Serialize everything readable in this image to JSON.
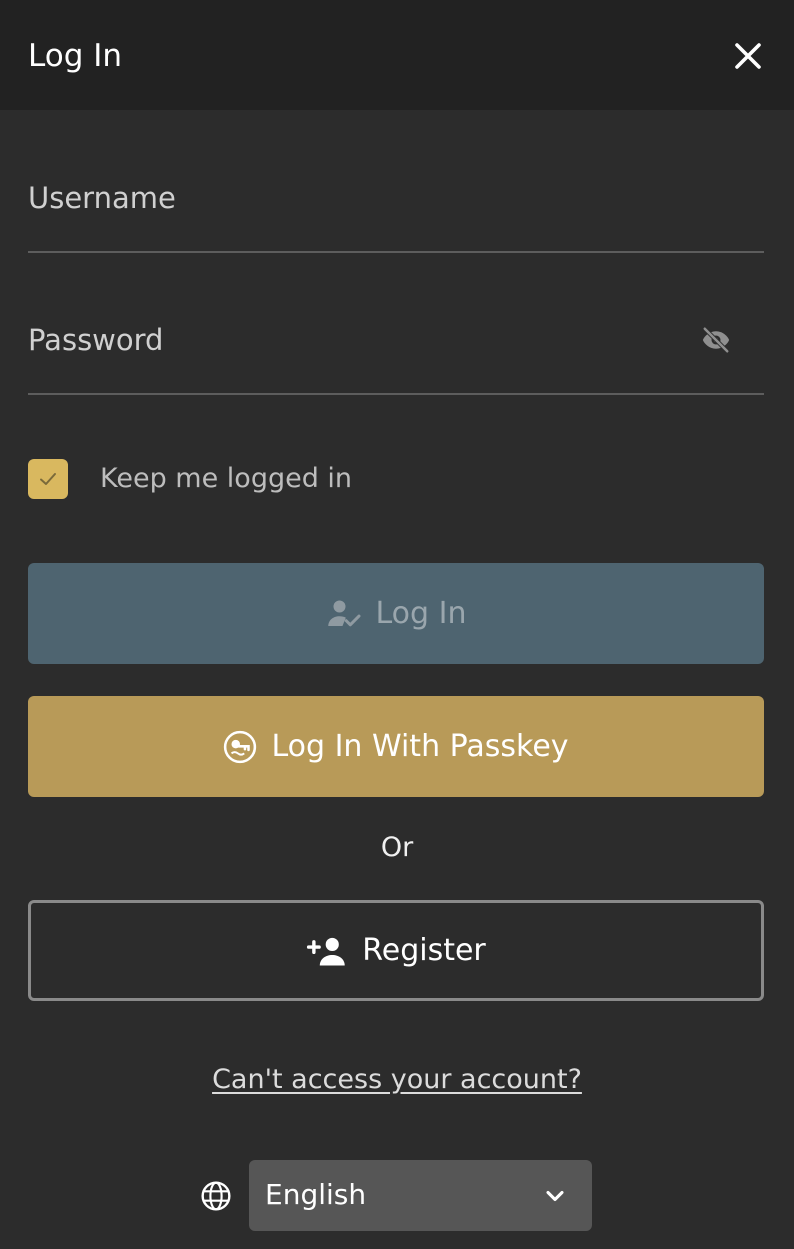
{
  "header": {
    "title": "Log In"
  },
  "form": {
    "username_placeholder": "Username",
    "username_value": "",
    "password_placeholder": "Password",
    "password_value": "",
    "keep_logged_in_label": "Keep me logged in",
    "keep_logged_in_checked": true
  },
  "buttons": {
    "login_label": "Log In",
    "passkey_label": "Log In With Passkey",
    "or_text": "Or",
    "register_label": "Register"
  },
  "links": {
    "forgot": "Can't access your account?"
  },
  "language": {
    "selected": "English"
  },
  "icons": {
    "close": "close-icon",
    "password_visibility": "eye-off-icon",
    "checkbox": "check-icon",
    "login": "user-check-icon",
    "passkey": "passkey-icon",
    "register": "user-plus-icon",
    "language": "globe-icon",
    "dropdown": "chevron-down-icon"
  },
  "colors": {
    "background": "#2c2c2c",
    "header": "#222222",
    "accent_gold": "#d9b85f",
    "passkey_button": "#b89a58",
    "login_button_disabled": "#4e6470",
    "select_bg": "#565656"
  }
}
